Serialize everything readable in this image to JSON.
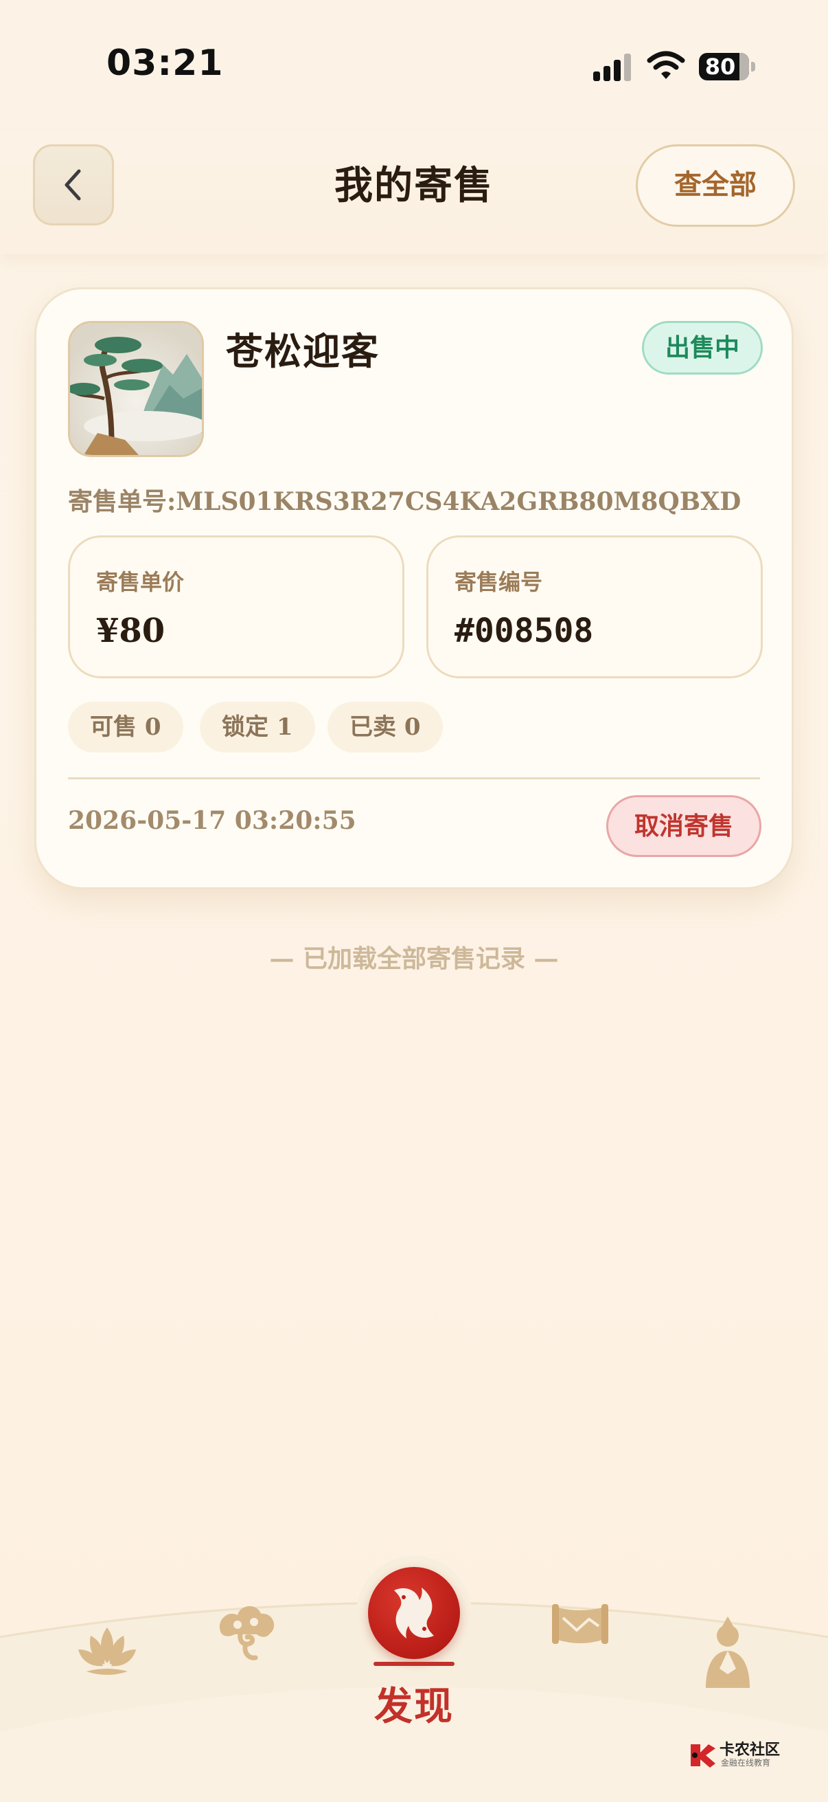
{
  "status_bar": {
    "time": "03:21",
    "battery": "80"
  },
  "header": {
    "title": "我的寄售",
    "view_all_label": "查全部"
  },
  "consignment": {
    "item_name": "苍松迎客",
    "status": "出售中",
    "status_color": "#1d8a5c",
    "order_label": "寄售单号:",
    "order_number": "MLS01KRS3R27CS4KA2GRB80M8QBXD",
    "price_label": "寄售单价",
    "price_value": "¥80",
    "serial_label": "寄售编号",
    "serial_value": "#008508",
    "stock": {
      "available": "可售 0",
      "locked": "锁定 1",
      "sold": "已卖 0"
    },
    "timestamp": "2026-05-17 03:20:55",
    "cancel_label": "取消寄售",
    "cancel_color": "#c0352e"
  },
  "list_end_note": "— 已加载全部寄售记录 —",
  "bottom_nav": {
    "items": [
      {
        "icon": "lotus-icon"
      },
      {
        "icon": "cloud-icon"
      },
      {
        "icon": "fish-yinyang-icon",
        "label": "发现",
        "active": true
      },
      {
        "icon": "scroll-icon"
      },
      {
        "icon": "person-icon"
      }
    ],
    "accent": "#c2312a",
    "icon_color": "#d9b98a"
  },
  "watermark": {
    "title": "卡农社区",
    "subtitle": "金融在线教育"
  }
}
